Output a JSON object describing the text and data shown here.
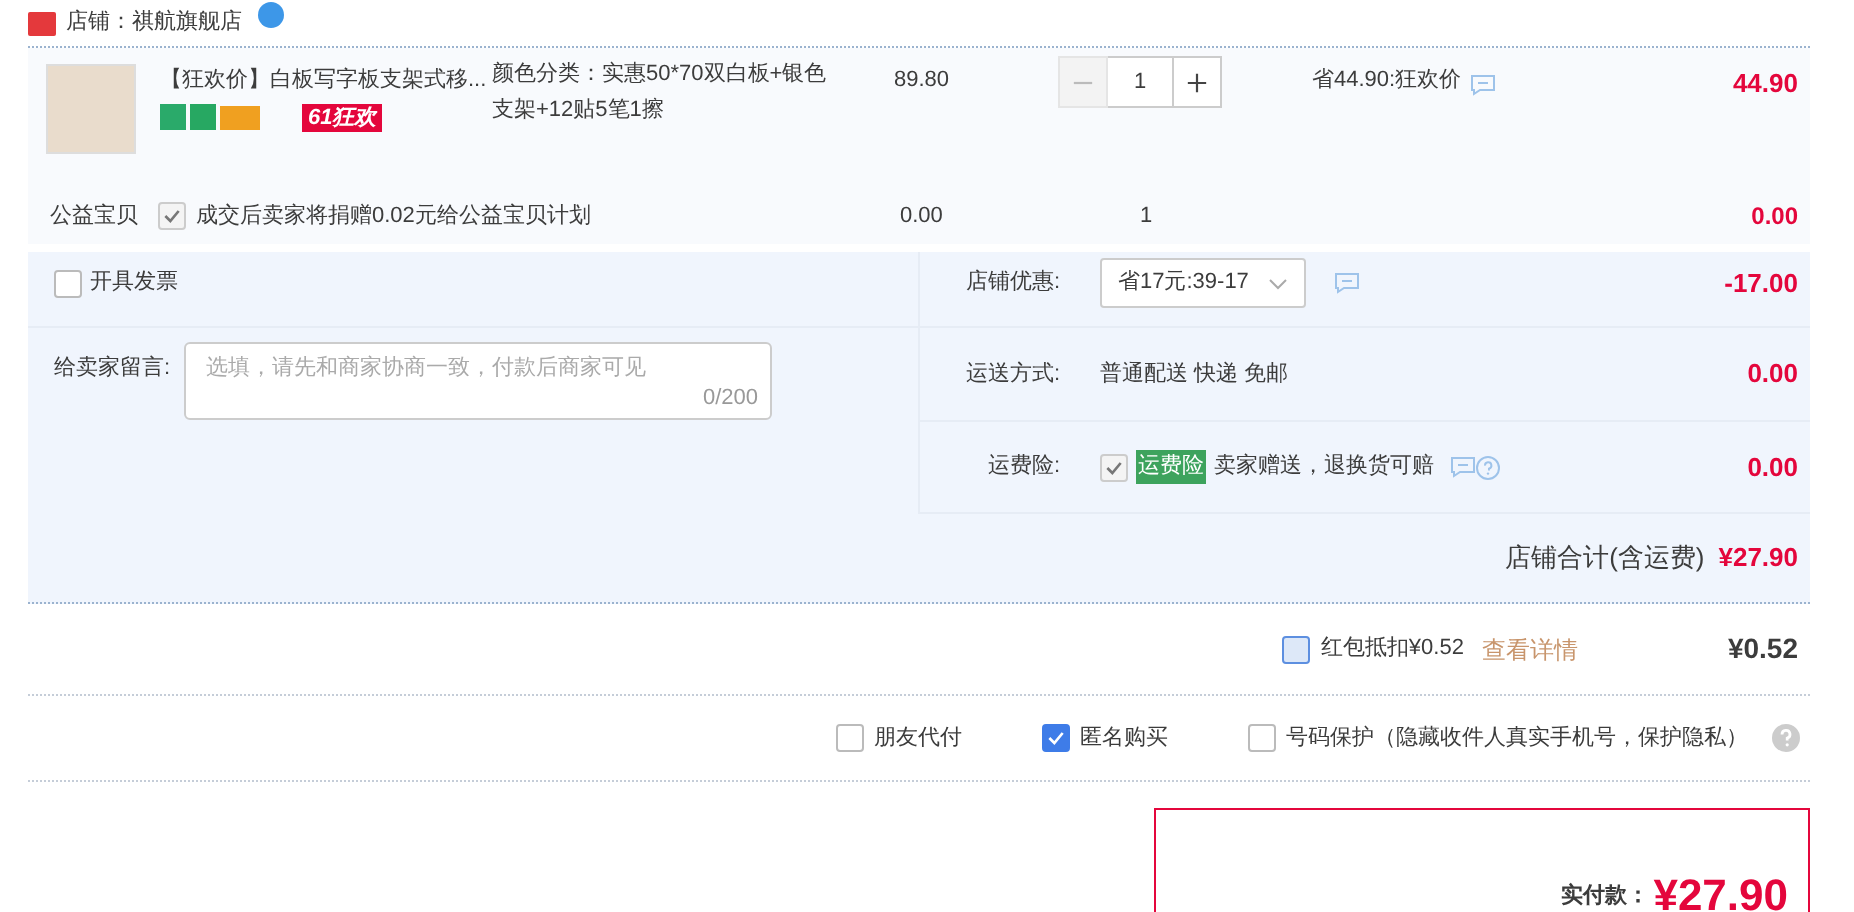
{
  "store": {
    "name": "店铺：祺航旗舰店"
  },
  "item": {
    "title": "【狂欢价】白板写字板支架式移...",
    "promo_tag": "61狂欢",
    "spec": "颜色分类：实惠50*70双白板+银色支架+12贴5笔1擦",
    "price": "89.80",
    "quantity": "1",
    "discount": "省44.90:狂欢价",
    "subtotal": "44.90"
  },
  "charity": {
    "label": "公益宝贝",
    "checked": true,
    "text": "成交后卖家将捐赠0.02元给公益宝贝计划",
    "price": "0.00",
    "quantity": "1",
    "subtotal": "0.00"
  },
  "invoice": {
    "label": "开具发票",
    "checked": false
  },
  "message": {
    "label": "给卖家留言:",
    "placeholder": "选填，请先和商家协商一致，付款后商家可见",
    "counter": "0/200"
  },
  "rows": [
    {
      "kind": "select",
      "label": "店铺优惠:",
      "value": "省17元:39-17",
      "amount": "-17.00"
    },
    {
      "kind": "text",
      "label": "运送方式:",
      "value": "普通配送 快递 免邮",
      "amount": "0.00"
    },
    {
      "kind": "insurance",
      "label": "运费险:",
      "checked": true,
      "tag": "运费险",
      "value": "卖家赠送，退换货可赔",
      "amount": "0.00"
    }
  ],
  "store_total": {
    "label": "店铺合计(含运费)",
    "amount": "¥27.90"
  },
  "cash_coupon": {
    "label": "红包抵扣¥0.52",
    "checked": false,
    "link": "查看详情",
    "amount": "¥0.52"
  },
  "options": [
    {
      "label": "朋友代付",
      "checked": false
    },
    {
      "label": "匿名购买",
      "checked": true
    },
    {
      "label": "号码保护（隐藏收件人真实手机号，保护隐私）",
      "checked": false
    }
  ],
  "pay": {
    "label": "实付款：",
    "amount": "¥27.90"
  }
}
